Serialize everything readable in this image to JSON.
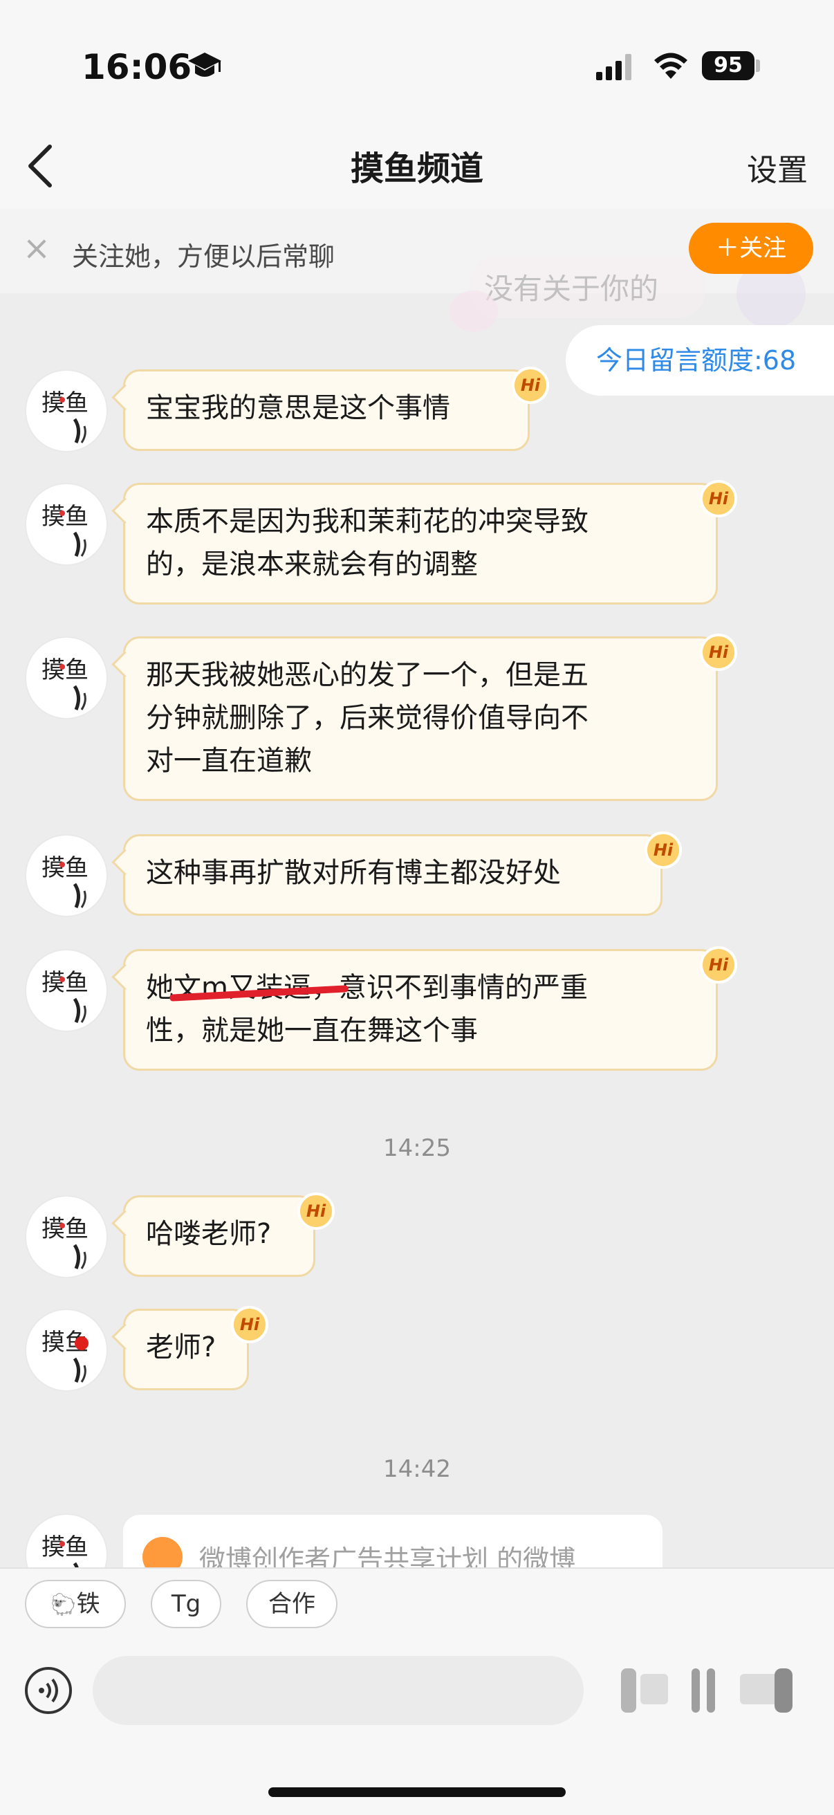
{
  "status_bar": {
    "time": "16:06",
    "battery": "95"
  },
  "nav": {
    "title": "摸鱼频道",
    "settings_label": "设置"
  },
  "banner": {
    "text": "关注她，方便以后常聊",
    "follow_label": "＋关注"
  },
  "background": {
    "faded_text": "没有关于你的"
  },
  "quota": {
    "text": "今日留言额度:68"
  },
  "messages": [
    {
      "text": "宝宝我的意思是这个事情"
    },
    {
      "text": "本质不是因为我和茉莉花的冲突导致\n的，是浪本来就会有的调整"
    },
    {
      "text": "那天我被她恶心的发了一个，但是五\n分钟就删除了，后来觉得价值导向不\n对一直在道歉"
    },
    {
      "text": "这种事再扩散对所有博主都没好处"
    },
    {
      "pre": "她",
      "struck": "文m又装逼，",
      "post_line1": "意识不到事情的严重",
      "line2": "性，就是她一直在舞这个事"
    },
    {
      "text": "哈喽老师?"
    },
    {
      "text": "老师?"
    }
  ],
  "hi_badge": "Hi",
  "avatar_label": "摸鱼",
  "timestamps": [
    "14:25",
    "14:42"
  ],
  "card": {
    "text": "微博创作者广告共享计划 的微博"
  },
  "quick_replies": [
    "铁",
    "Tg",
    "合作"
  ],
  "colors": {
    "accent_orange": "#ff8c00",
    "bubble_bg": "#fffaf0",
    "bubble_border": "#f1d9a6",
    "link_blue": "#2e8ae6"
  }
}
